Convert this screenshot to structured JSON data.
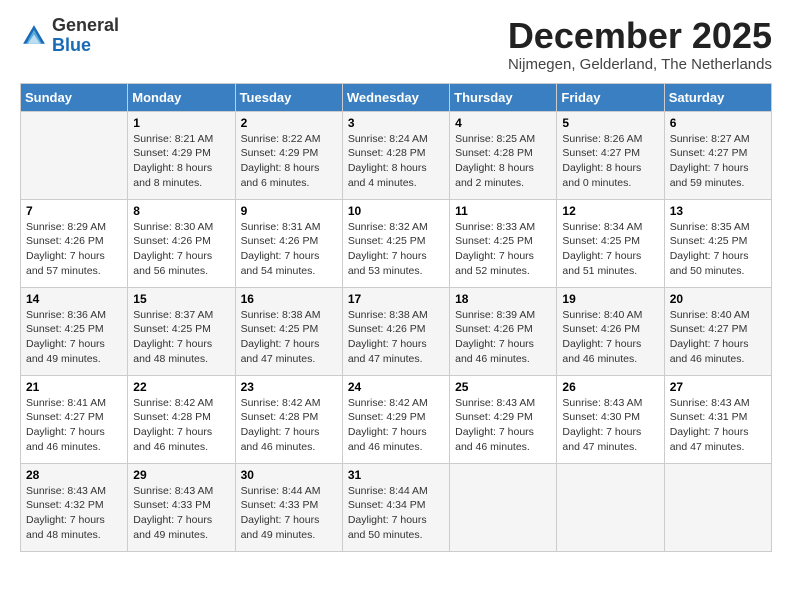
{
  "logo": {
    "general": "General",
    "blue": "Blue"
  },
  "header": {
    "month_year": "December 2025",
    "location": "Nijmegen, Gelderland, The Netherlands"
  },
  "days_of_week": [
    "Sunday",
    "Monday",
    "Tuesday",
    "Wednesday",
    "Thursday",
    "Friday",
    "Saturday"
  ],
  "weeks": [
    [
      {
        "day": "",
        "sunrise": "",
        "sunset": "",
        "daylight": ""
      },
      {
        "day": "1",
        "sunrise": "Sunrise: 8:21 AM",
        "sunset": "Sunset: 4:29 PM",
        "daylight": "Daylight: 8 hours and 8 minutes."
      },
      {
        "day": "2",
        "sunrise": "Sunrise: 8:22 AM",
        "sunset": "Sunset: 4:29 PM",
        "daylight": "Daylight: 8 hours and 6 minutes."
      },
      {
        "day": "3",
        "sunrise": "Sunrise: 8:24 AM",
        "sunset": "Sunset: 4:28 PM",
        "daylight": "Daylight: 8 hours and 4 minutes."
      },
      {
        "day": "4",
        "sunrise": "Sunrise: 8:25 AM",
        "sunset": "Sunset: 4:28 PM",
        "daylight": "Daylight: 8 hours and 2 minutes."
      },
      {
        "day": "5",
        "sunrise": "Sunrise: 8:26 AM",
        "sunset": "Sunset: 4:27 PM",
        "daylight": "Daylight: 8 hours and 0 minutes."
      },
      {
        "day": "6",
        "sunrise": "Sunrise: 8:27 AM",
        "sunset": "Sunset: 4:27 PM",
        "daylight": "Daylight: 7 hours and 59 minutes."
      }
    ],
    [
      {
        "day": "7",
        "sunrise": "Sunrise: 8:29 AM",
        "sunset": "Sunset: 4:26 PM",
        "daylight": "Daylight: 7 hours and 57 minutes."
      },
      {
        "day": "8",
        "sunrise": "Sunrise: 8:30 AM",
        "sunset": "Sunset: 4:26 PM",
        "daylight": "Daylight: 7 hours and 56 minutes."
      },
      {
        "day": "9",
        "sunrise": "Sunrise: 8:31 AM",
        "sunset": "Sunset: 4:26 PM",
        "daylight": "Daylight: 7 hours and 54 minutes."
      },
      {
        "day": "10",
        "sunrise": "Sunrise: 8:32 AM",
        "sunset": "Sunset: 4:25 PM",
        "daylight": "Daylight: 7 hours and 53 minutes."
      },
      {
        "day": "11",
        "sunrise": "Sunrise: 8:33 AM",
        "sunset": "Sunset: 4:25 PM",
        "daylight": "Daylight: 7 hours and 52 minutes."
      },
      {
        "day": "12",
        "sunrise": "Sunrise: 8:34 AM",
        "sunset": "Sunset: 4:25 PM",
        "daylight": "Daylight: 7 hours and 51 minutes."
      },
      {
        "day": "13",
        "sunrise": "Sunrise: 8:35 AM",
        "sunset": "Sunset: 4:25 PM",
        "daylight": "Daylight: 7 hours and 50 minutes."
      }
    ],
    [
      {
        "day": "14",
        "sunrise": "Sunrise: 8:36 AM",
        "sunset": "Sunset: 4:25 PM",
        "daylight": "Daylight: 7 hours and 49 minutes."
      },
      {
        "day": "15",
        "sunrise": "Sunrise: 8:37 AM",
        "sunset": "Sunset: 4:25 PM",
        "daylight": "Daylight: 7 hours and 48 minutes."
      },
      {
        "day": "16",
        "sunrise": "Sunrise: 8:38 AM",
        "sunset": "Sunset: 4:25 PM",
        "daylight": "Daylight: 7 hours and 47 minutes."
      },
      {
        "day": "17",
        "sunrise": "Sunrise: 8:38 AM",
        "sunset": "Sunset: 4:26 PM",
        "daylight": "Daylight: 7 hours and 47 minutes."
      },
      {
        "day": "18",
        "sunrise": "Sunrise: 8:39 AM",
        "sunset": "Sunset: 4:26 PM",
        "daylight": "Daylight: 7 hours and 46 minutes."
      },
      {
        "day": "19",
        "sunrise": "Sunrise: 8:40 AM",
        "sunset": "Sunset: 4:26 PM",
        "daylight": "Daylight: 7 hours and 46 minutes."
      },
      {
        "day": "20",
        "sunrise": "Sunrise: 8:40 AM",
        "sunset": "Sunset: 4:27 PM",
        "daylight": "Daylight: 7 hours and 46 minutes."
      }
    ],
    [
      {
        "day": "21",
        "sunrise": "Sunrise: 8:41 AM",
        "sunset": "Sunset: 4:27 PM",
        "daylight": "Daylight: 7 hours and 46 minutes."
      },
      {
        "day": "22",
        "sunrise": "Sunrise: 8:42 AM",
        "sunset": "Sunset: 4:28 PM",
        "daylight": "Daylight: 7 hours and 46 minutes."
      },
      {
        "day": "23",
        "sunrise": "Sunrise: 8:42 AM",
        "sunset": "Sunset: 4:28 PM",
        "daylight": "Daylight: 7 hours and 46 minutes."
      },
      {
        "day": "24",
        "sunrise": "Sunrise: 8:42 AM",
        "sunset": "Sunset: 4:29 PM",
        "daylight": "Daylight: 7 hours and 46 minutes."
      },
      {
        "day": "25",
        "sunrise": "Sunrise: 8:43 AM",
        "sunset": "Sunset: 4:29 PM",
        "daylight": "Daylight: 7 hours and 46 minutes."
      },
      {
        "day": "26",
        "sunrise": "Sunrise: 8:43 AM",
        "sunset": "Sunset: 4:30 PM",
        "daylight": "Daylight: 7 hours and 47 minutes."
      },
      {
        "day": "27",
        "sunrise": "Sunrise: 8:43 AM",
        "sunset": "Sunset: 4:31 PM",
        "daylight": "Daylight: 7 hours and 47 minutes."
      }
    ],
    [
      {
        "day": "28",
        "sunrise": "Sunrise: 8:43 AM",
        "sunset": "Sunset: 4:32 PM",
        "daylight": "Daylight: 7 hours and 48 minutes."
      },
      {
        "day": "29",
        "sunrise": "Sunrise: 8:43 AM",
        "sunset": "Sunset: 4:33 PM",
        "daylight": "Daylight: 7 hours and 49 minutes."
      },
      {
        "day": "30",
        "sunrise": "Sunrise: 8:44 AM",
        "sunset": "Sunset: 4:33 PM",
        "daylight": "Daylight: 7 hours and 49 minutes."
      },
      {
        "day": "31",
        "sunrise": "Sunrise: 8:44 AM",
        "sunset": "Sunset: 4:34 PM",
        "daylight": "Daylight: 7 hours and 50 minutes."
      },
      {
        "day": "",
        "sunrise": "",
        "sunset": "",
        "daylight": ""
      },
      {
        "day": "",
        "sunrise": "",
        "sunset": "",
        "daylight": ""
      },
      {
        "day": "",
        "sunrise": "",
        "sunset": "",
        "daylight": ""
      }
    ]
  ]
}
